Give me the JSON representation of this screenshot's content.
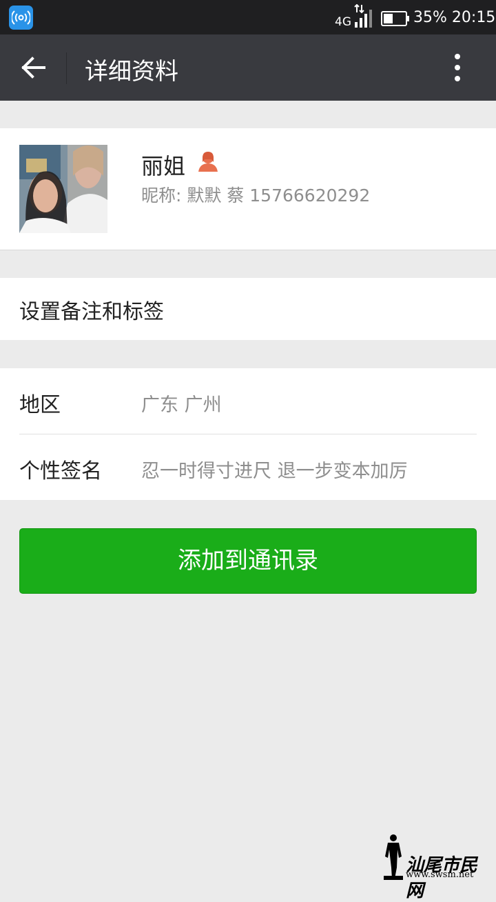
{
  "status_bar": {
    "network": "4G",
    "battery": "35%",
    "time": "20:15",
    "icons": [
      "wifi-key-app-icon",
      "data-arrows-icon",
      "signal-bars-icon",
      "battery-icon"
    ]
  },
  "app_bar": {
    "title": "详细资料",
    "icons": [
      "back-arrow-icon",
      "more-vertical-icon"
    ]
  },
  "profile": {
    "name": "丽姐",
    "nickname": "昵称: 默默 蔡 15766620292",
    "gender_icon": "female-icon",
    "gender_color": "#e8704f"
  },
  "remark": {
    "label": "设置备注和标签"
  },
  "info": {
    "rows": [
      {
        "label": "地区",
        "value": "广东  广州"
      },
      {
        "label": "个性签名",
        "value": "忍一时得寸进尺  退一步变本加厉"
      }
    ]
  },
  "actions": {
    "add_contact_label": "添加到通讯录",
    "accent": "#1aad19"
  },
  "watermark": {
    "logo_text": "汕尾市民网",
    "url": "www.swsm.net"
  }
}
